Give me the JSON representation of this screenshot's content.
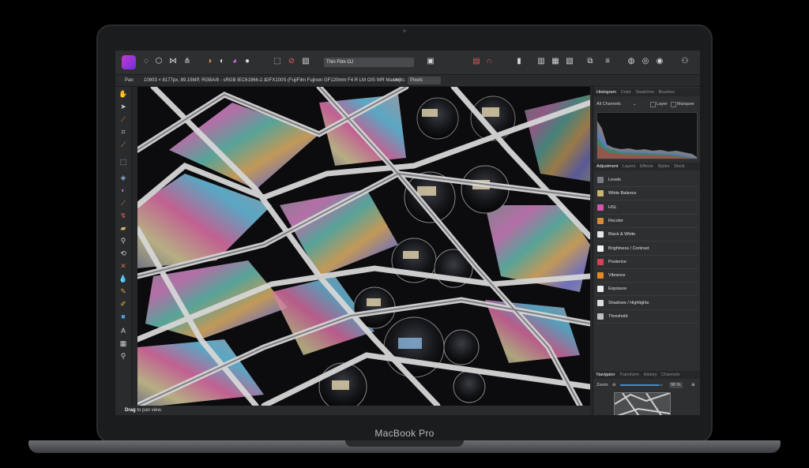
{
  "device": {
    "chin_label": "MacBook Pro"
  },
  "toolbar": {
    "search_value": "Thin Film OJ",
    "icons": [
      "app-icon",
      "persona-photo-icon",
      "persona-liquify-icon",
      "persona-develop-icon",
      "persona-tone-map-icon",
      "persona-export-icon",
      "auto-levels-icon",
      "auto-contrast-icon",
      "auto-colors-icon",
      "auto-white-balance-icon",
      "selection-icon",
      "no-selection-icon",
      "invert-icon",
      "quick-mask-icon",
      "snapping-icon",
      "magnet-icon",
      "assistant-icon",
      "order-icon",
      "align-icon",
      "transform-icon",
      "flip-icon",
      "rotate-icon",
      "layer-icon",
      "mask-icon",
      "studio-icon",
      "user-icon"
    ]
  },
  "context": {
    "tool": "Pan",
    "image_info": "10903 × 8177px, 89.15MP, RGBA/8 - sRGB IEC61966-2.1",
    "camera_info": "GFX100S (FujiFilm Fujinon GF120mm F4 R LM OIS WR Macro)",
    "units_label": "Units:",
    "units_value": "Pixels"
  },
  "status": {
    "bold": "Drag",
    "text": " to pan view."
  },
  "histogram_panel": {
    "tabs": [
      "Histogram",
      "Color",
      "Swatches",
      "Brushes"
    ],
    "channel": "All Channels",
    "layer_label": "Layer",
    "marquee_label": "Marquee"
  },
  "adjustment_panel": {
    "tabs": [
      "Adjustment",
      "Layers",
      "Effects",
      "Styles",
      "Stock"
    ],
    "items": [
      {
        "label": "Levels",
        "color": "#7a7d85"
      },
      {
        "label": "White Balance",
        "color": "#c7b66a"
      },
      {
        "label": "HSL",
        "color": "#d057a8"
      },
      {
        "label": "Recolor",
        "color": "#d98a3a"
      },
      {
        "label": "Black & White",
        "color": "#e6e6e6"
      },
      {
        "label": "Brightness / Contrast",
        "color": "#f2f2f2"
      },
      {
        "label": "Posterize",
        "color": "#d1435b"
      },
      {
        "label": "Vibrance",
        "color": "#e08a2a"
      },
      {
        "label": "Exposure",
        "color": "#ededed"
      },
      {
        "label": "Shadows / Highlights",
        "color": "#dcdcdc"
      },
      {
        "label": "Threshold",
        "color": "#bfbfbf"
      }
    ]
  },
  "navigator_panel": {
    "tabs": [
      "Navigator",
      "Transform",
      "History",
      "Channels"
    ],
    "zoom_label": "Zoom:",
    "zoom_value": "90 %",
    "zoom_fraction": 0.9
  }
}
